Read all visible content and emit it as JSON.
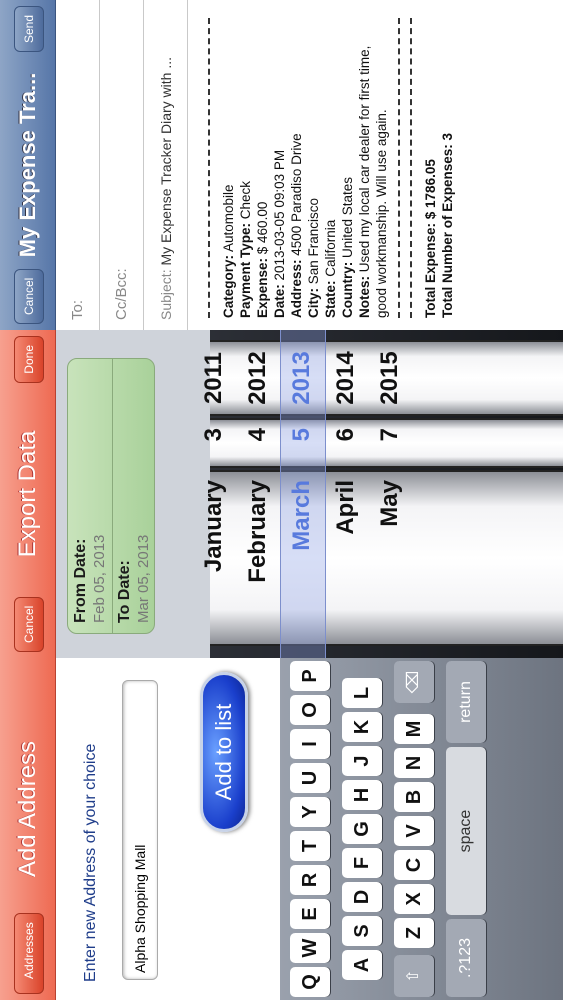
{
  "add_address": {
    "nav": {
      "back_label": "Addresses",
      "title": "Add Address"
    },
    "hint": "Enter new Address of your choice",
    "input_value": "Alpha Shopping Mall",
    "add_button": "Add to list",
    "keyboard": {
      "row1": [
        "Q",
        "W",
        "E",
        "R",
        "T",
        "Y",
        "U",
        "I",
        "O",
        "P"
      ],
      "row2": [
        "A",
        "S",
        "D",
        "F",
        "G",
        "H",
        "J",
        "K",
        "L"
      ],
      "row3": [
        "Z",
        "X",
        "C",
        "V",
        "B",
        "N",
        "M"
      ],
      "shift": "⇧",
      "delete": "⌫",
      "numbers": ".?123",
      "space": "space",
      "return": "return"
    }
  },
  "export_data": {
    "nav": {
      "cancel_label": "Cancel",
      "title": "Export Data",
      "done_label": "Done"
    },
    "from_label": "From Date:",
    "from_value": "Feb 05, 2013",
    "to_label": "To Date:",
    "to_value": "Mar 05, 2013",
    "picker": {
      "months": [
        "January",
        "February",
        "March",
        "April",
        "May"
      ],
      "days": [
        "3",
        "4",
        "5",
        "6",
        "7"
      ],
      "years": [
        "2011",
        "2012",
        "2013",
        "2014",
        "2015"
      ],
      "selected_index": 2
    }
  },
  "mail": {
    "nav": {
      "cancel_label": "Cancel",
      "title": "My Expense Tra...",
      "send_label": "Send"
    },
    "to_label": "To:",
    "cc_label": "Cc/Bcc:",
    "subject_label": "Subject:",
    "subject_value": "My Expense Tracker Diary with ...",
    "body": {
      "category_label": "Category:",
      "category_value": " Automobile",
      "payment_label": "Payment Type:",
      "payment_value": " Check",
      "expense_label": "Expense:",
      "expense_value": " $ 460.00",
      "date_label": "Date:",
      "date_value": " 2013-03-05 09:03 PM",
      "address_label": "Address:",
      "address_value": " 4500 Paradiso Drive",
      "city_label": "City:",
      "city_value": " San Francisco",
      "state_label": "State:",
      "state_value": " California",
      "country_label": "Country:",
      "country_value": " United States",
      "notes_label": "Notes:",
      "notes_value": " Used my local car dealer for first time, good workmanship. Will use again.",
      "total_expense_label": "Total Expense:",
      "total_expense_value": " $ 1786.05",
      "total_count_label": "Total Number of Expenses:",
      "total_count_value": " 3"
    }
  },
  "colors": {
    "red_nav": "#ee6a52",
    "blue_nav": "#5676a8",
    "accent_blue": "#1a3fcc",
    "picker_selected": "#3d66d9"
  }
}
